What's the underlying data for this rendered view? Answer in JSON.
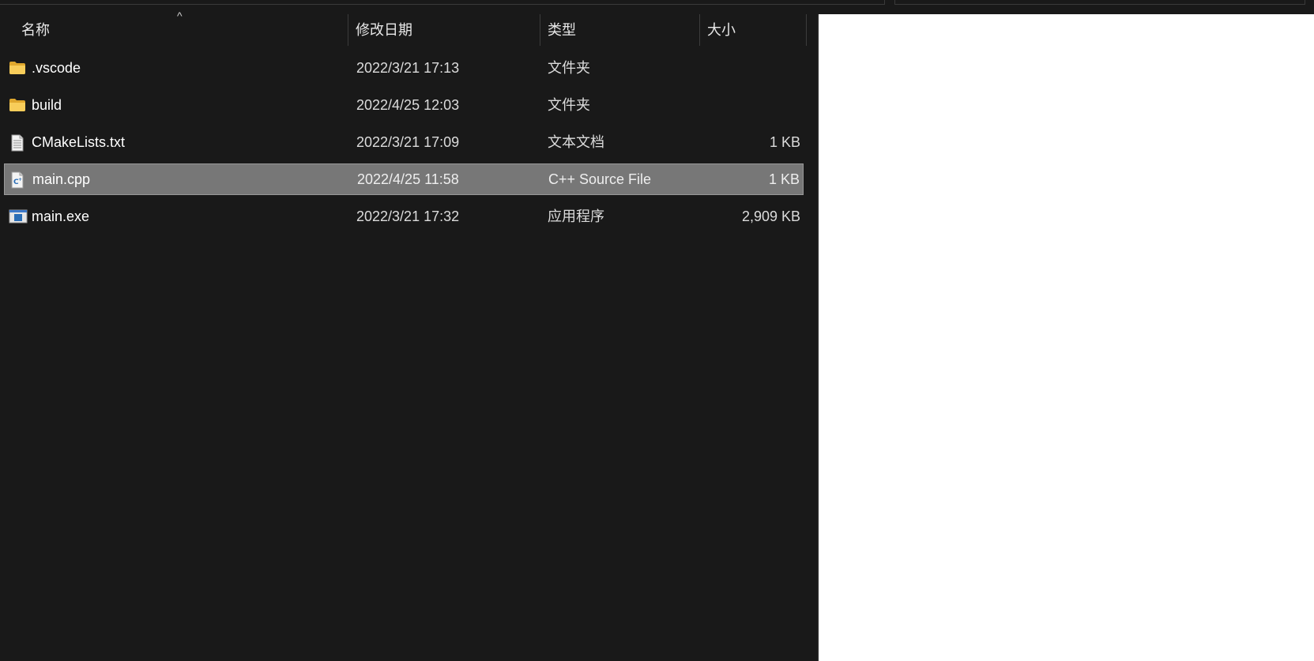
{
  "columns": {
    "name": "名称",
    "date": "修改日期",
    "type": "类型",
    "size": "大小"
  },
  "files": [
    {
      "name": ".vscode",
      "date": "2022/3/21 17:13",
      "type": "文件夹",
      "size": "",
      "icon": "folder-icon"
    },
    {
      "name": "build",
      "date": "2022/4/25 12:03",
      "type": "文件夹",
      "size": "",
      "icon": "folder-icon"
    },
    {
      "name": "CMakeLists.txt",
      "date": "2022/3/21 17:09",
      "type": "文本文档",
      "size": "1 KB",
      "icon": "text-file-icon"
    },
    {
      "name": "main.cpp",
      "date": "2022/4/25 11:58",
      "type": "C++ Source File",
      "size": "1 KB",
      "icon": "cpp-file-icon",
      "selected": true
    },
    {
      "name": "main.exe",
      "date": "2022/3/21 17:32",
      "type": "应用程序",
      "size": "2,909 KB",
      "icon": "exe-file-icon"
    }
  ],
  "colors": {
    "background": "#191919",
    "selection": "#777777",
    "folder": "#f5c451"
  }
}
